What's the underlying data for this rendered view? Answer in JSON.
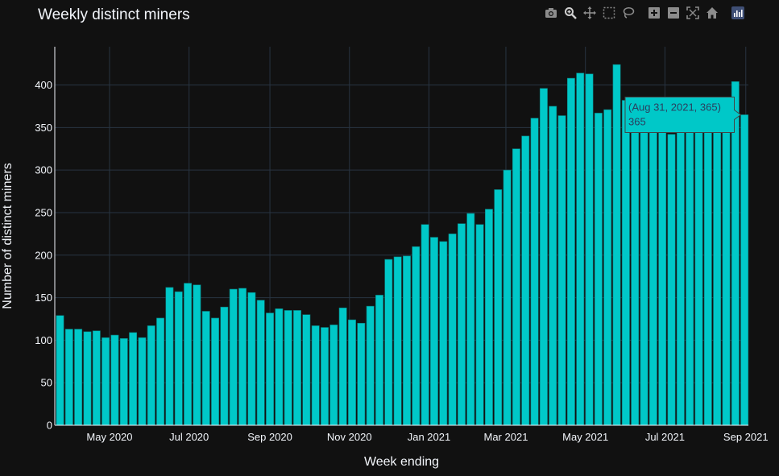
{
  "chart_data": {
    "type": "bar",
    "title": "Weekly distinct miners",
    "xlabel": "Week ending",
    "ylabel": "Number of distinct miners",
    "ylim": [
      0,
      445
    ],
    "yticks": [
      0,
      50,
      100,
      150,
      200,
      250,
      300,
      350,
      400
    ],
    "xticks": [
      {
        "label": "May 2020",
        "date": "2020-05-01"
      },
      {
        "label": "Jul 2020",
        "date": "2020-07-01"
      },
      {
        "label": "Sep 2020",
        "date": "2020-09-01"
      },
      {
        "label": "Nov 2020",
        "date": "2020-11-01"
      },
      {
        "label": "Jan 2021",
        "date": "2021-01-01"
      },
      {
        "label": "Mar 2021",
        "date": "2021-03-01"
      },
      {
        "label": "May 2021",
        "date": "2021-05-01"
      },
      {
        "label": "Jul 2021",
        "date": "2021-07-01"
      },
      {
        "label": "Sep 2021",
        "date": "2021-09-01"
      }
    ],
    "x_range": [
      "2020-03-20",
      "2021-09-03"
    ],
    "first_week": "2020-03-24",
    "values": [
      129,
      113,
      113,
      110,
      111,
      103,
      106,
      102,
      109,
      103,
      117,
      126,
      162,
      157,
      167,
      165,
      134,
      126,
      139,
      160,
      161,
      156,
      147,
      132,
      137,
      135,
      135,
      130,
      117,
      115,
      118,
      138,
      124,
      120,
      140,
      153,
      195,
      198,
      199,
      210,
      236,
      221,
      216,
      225,
      237,
      249,
      236,
      254,
      277,
      300,
      325,
      340,
      361,
      396,
      375,
      364,
      408,
      414,
      413,
      367,
      371,
      424,
      382,
      354,
      370,
      352,
      358,
      342,
      350,
      356,
      363,
      367,
      375,
      383,
      404,
      365
    ],
    "bar_color": "#00c8c8",
    "bar_outline": "#0a7a7a",
    "grid": true,
    "tooltip": {
      "line1": "(Aug 31, 2021, 365)",
      "line2": "365"
    }
  },
  "modebar": {
    "icons": [
      "camera-icon",
      "zoom-icon",
      "pan-icon",
      "box-select-icon",
      "lasso-select-icon",
      "zoom-in-icon",
      "zoom-out-icon",
      "autoscale-icon",
      "reset-axes-icon",
      "plotly-logo-icon"
    ]
  }
}
